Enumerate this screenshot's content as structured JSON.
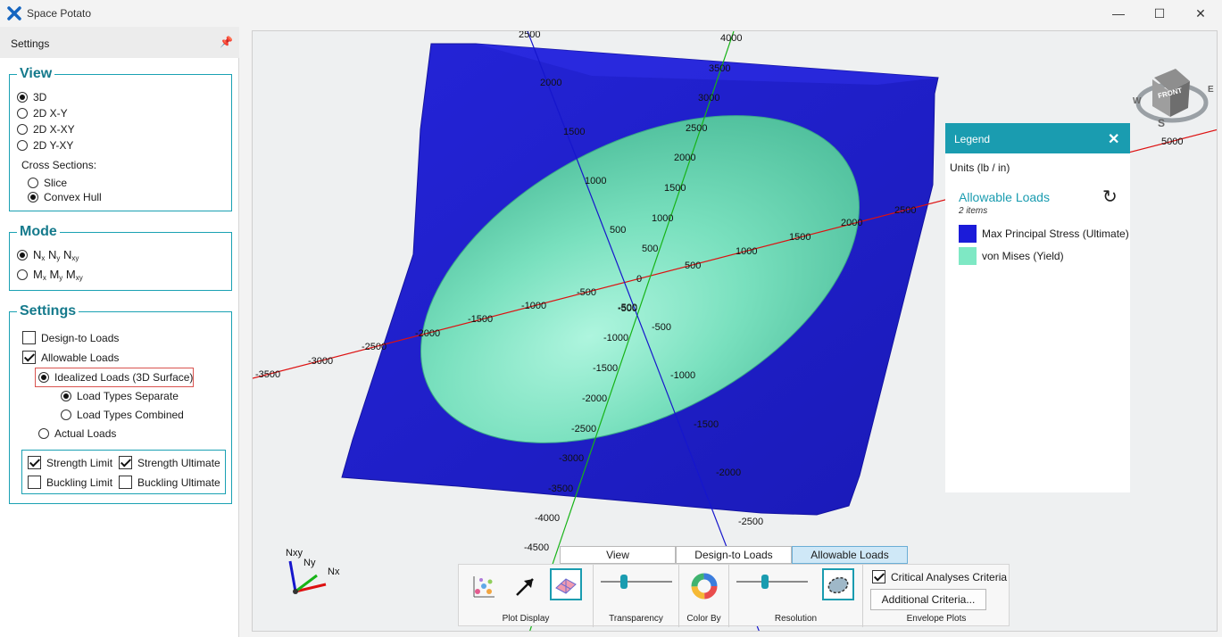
{
  "window": {
    "title": "Space Potato",
    "minimize": "—",
    "maximize": "☐",
    "close": "✕"
  },
  "sidebar": {
    "header": "Settings",
    "view": {
      "title": "View",
      "options": [
        "3D",
        "2D X-Y",
        "2D X-XY",
        "2D Y-XY"
      ],
      "selected": "3D",
      "cross_sections_label": "Cross Sections:",
      "cross_sections": [
        "Slice",
        "Convex Hull"
      ],
      "cross_selected": "Convex Hull"
    },
    "mode": {
      "title": "Mode",
      "options": [
        {
          "parts": [
            "N",
            "x",
            " N",
            "y",
            " N",
            "xy"
          ],
          "selected": true
        },
        {
          "parts": [
            "M",
            "x",
            " M",
            "y",
            " M",
            "xy"
          ],
          "selected": false
        }
      ]
    },
    "settings": {
      "title": "Settings",
      "design_to_loads": "Design-to Loads",
      "allowable_loads": "Allowable Loads",
      "idealized": "Idealized Loads (3D Surface)",
      "load_types_separate": "Load Types Separate",
      "load_types_combined": "Load Types Combined",
      "actual_loads": "Actual Loads",
      "strength_limit": "Strength Limit",
      "strength_ultimate": "Strength Ultimate",
      "buckling_limit": "Buckling Limit",
      "buckling_ultimate": "Buckling Ultimate"
    }
  },
  "legend": {
    "title": "Legend",
    "close": "✕",
    "units": "Units (lb / in)",
    "group": "Allowable Loads",
    "count": "2 items",
    "refresh": "↻",
    "items": [
      {
        "label": "Max Principal Stress (Ultimate)",
        "color": "#1b1bd9"
      },
      {
        "label": "von Mises (Yield)",
        "color": "#7ee8c4"
      }
    ]
  },
  "axes": {
    "red_ticks": [
      "-3500",
      "-3000",
      "-2500",
      "-2000",
      "-1500",
      "-1000",
      "-500",
      "0",
      "500",
      "1000",
      "1500",
      "2000",
      "2500",
      "5000"
    ],
    "green_ticks": [
      "4000",
      "3500",
      "3000",
      "2500",
      "2000",
      "1500",
      "1000",
      "500",
      "-500",
      "-1000",
      "-1500",
      "-2000",
      "-2500",
      "-3000",
      "-3500",
      "-4000",
      "-4500"
    ],
    "blue_ticks": [
      "2500",
      "2000",
      "1500",
      "1000",
      "500",
      "-500",
      "-1000",
      "-1500",
      "-2000",
      "-2500"
    ],
    "triad": {
      "x": "Nx",
      "y": "Ny",
      "z": "Nxy"
    },
    "cube": {
      "front": "FRONT",
      "w": "W",
      "e": "E",
      "s": "S"
    }
  },
  "toolbar": {
    "tabs": [
      "View",
      "Design-to Loads",
      "Allowable Loads"
    ],
    "active_tab": "Allowable Loads",
    "plot_display": "Plot Display",
    "transparency": "Transparency",
    "color_by": "Color By",
    "resolution": "Resolution",
    "envelope_plots": "Envelope Plots",
    "critical": "Critical Analyses Criteria",
    "additional": "Additional Criteria...",
    "transparency_level": 0.35,
    "resolution_level": 0.4
  },
  "colors": {
    "accent": "#1a9cb0",
    "surface_outer": "#1b1bd9",
    "surface_inner": "#7ee8c4"
  }
}
